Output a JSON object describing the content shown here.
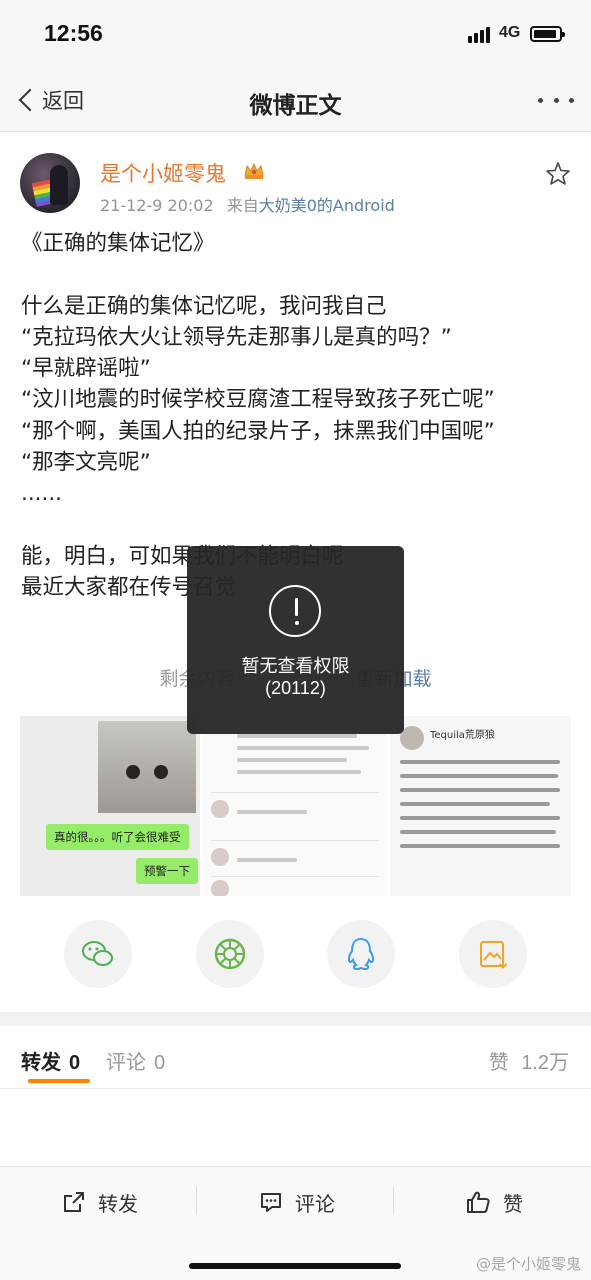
{
  "status_bar": {
    "time": "12:56",
    "network": "4G"
  },
  "nav": {
    "back_label": "返回",
    "title": "微博正文"
  },
  "author": {
    "name": "是个小姬零鬼",
    "timestamp": "21-12-9 20:02",
    "source_prefix": "来自",
    "source": "大奶美0的Android"
  },
  "post": {
    "lines": [
      "《正确的集体记忆》",
      "",
      "什么是正确的集体记忆呢，我问我自己",
      "“克拉玛依大火让领导先走那事儿是真的吗？”",
      "“早就辟谣啦”",
      "“汶川地震的时候学校豆腐渣工程导致孩子死亡呢”",
      "“那个啊，美国人拍的纪录片子，抹黑我们中国呢”",
      "“那李文亮呢”",
      "......",
      "",
      "能，明白，可如果我们不能明白呢",
      "最近大家都在传号召觉"
    ],
    "load_more_prefix": "剩余内容",
    "load_more_action": "重新加载"
  },
  "toast": {
    "message": "暂无查看权限",
    "code": "(20112)"
  },
  "images": {
    "chat_bubbles": [
      "真的很。。。听了会很难受",
      "预警一下"
    ],
    "panel3_user": "Tequila荒原狼"
  },
  "share": {
    "icons": [
      "wechat-icon",
      "moments-icon",
      "qq-icon",
      "save-image-icon"
    ]
  },
  "tabs": [
    {
      "label": "转发",
      "count": "0"
    },
    {
      "label": "评论",
      "count": "0"
    }
  ],
  "likes": {
    "label": "赞",
    "count": "1.2万"
  },
  "bottom_actions": [
    {
      "label": "转发"
    },
    {
      "label": "评论"
    },
    {
      "label": "赞"
    }
  ],
  "watermark": "@是个小姬零鬼",
  "colors": {
    "accent": "#ff8200",
    "author": "#e8772e",
    "link": "#5a7ea8"
  }
}
